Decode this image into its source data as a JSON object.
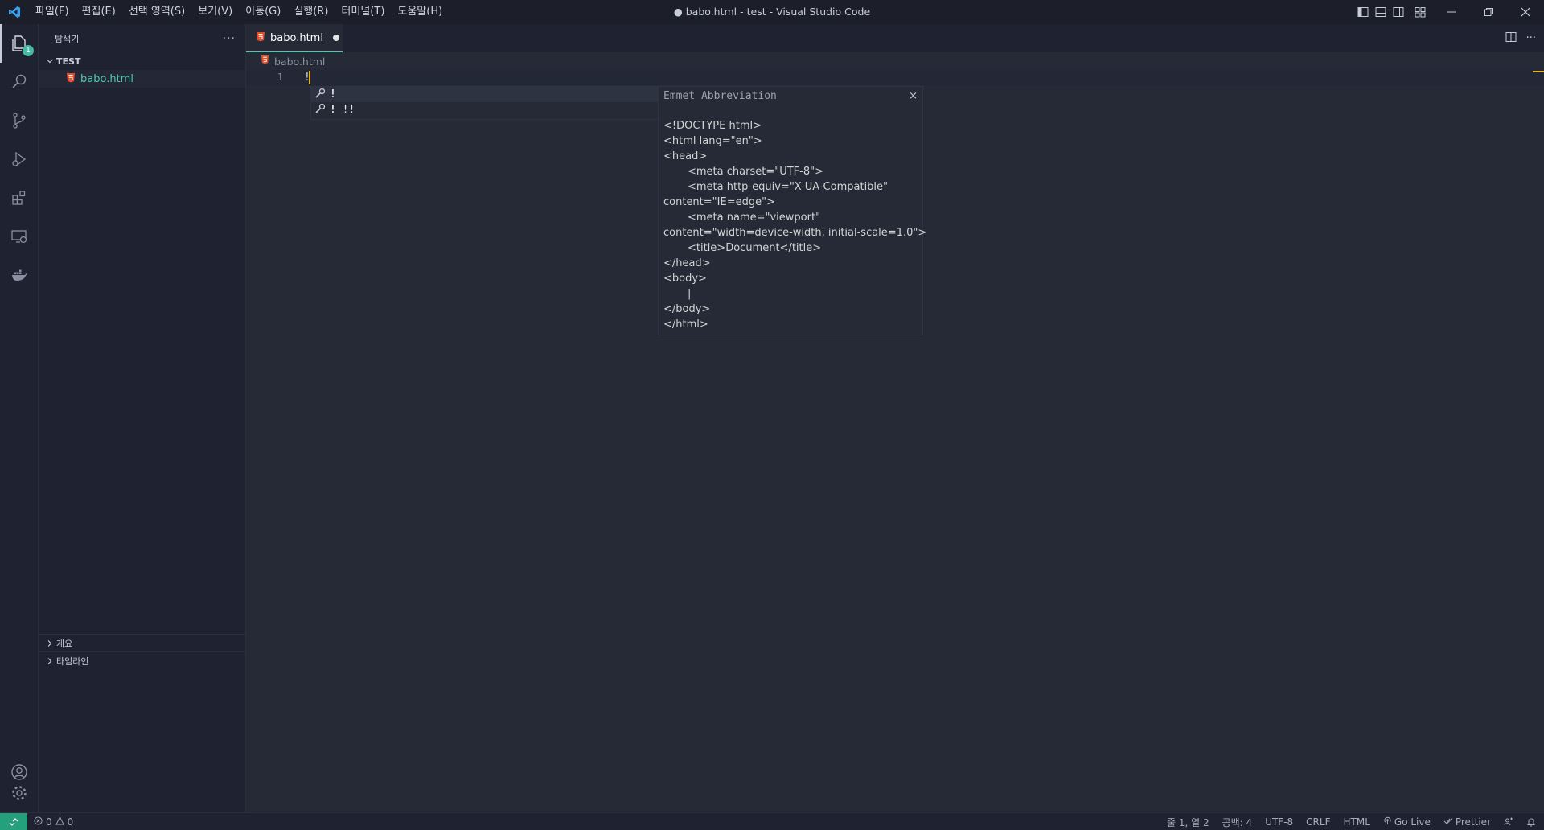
{
  "titlebar": {
    "title": "● babo.html - test - Visual Studio Code",
    "menu": [
      "파일(F)",
      "편집(E)",
      "선택 영역(S)",
      "보기(V)",
      "이동(G)",
      "실행(R)",
      "터미널(T)",
      "도움말(H)"
    ]
  },
  "activity": {
    "explorer_badge": "1"
  },
  "sidebar": {
    "title": "탐색기",
    "more": "···",
    "folder": "TEST",
    "file": "babo.html",
    "outline": "개요",
    "timeline": "타임라인"
  },
  "editor": {
    "tab_label": "babo.html",
    "breadcrumb": "babo.html",
    "line_number": "1",
    "line_text": "!",
    "suggestions": [
      {
        "label": "!",
        "rest": ""
      },
      {
        "label": "!",
        "rest": " !!"
      }
    ],
    "details": {
      "title": "Emmet Abbreviation",
      "close": "×",
      "lines": [
        {
          "text": "<!DOCTYPE html>",
          "indent": false
        },
        {
          "text": "<html lang=\"en\">",
          "indent": false
        },
        {
          "text": "<head>",
          "indent": false
        },
        {
          "text": "<meta charset=\"UTF-8\">",
          "indent": true
        },
        {
          "text": "<meta http-equiv=\"X-UA-Compatible\"",
          "indent": true
        },
        {
          "text": "content=\"IE=edge\">",
          "indent": false
        },
        {
          "text": "<meta name=\"viewport\"",
          "indent": true
        },
        {
          "text": "content=\"width=device-width, initial-scale=1.0\">",
          "indent": false
        },
        {
          "text": "<title>Document</title>",
          "indent": true
        },
        {
          "text": "</head>",
          "indent": false
        },
        {
          "text": "<body>",
          "indent": false
        },
        {
          "text": "|",
          "indent": true
        },
        {
          "text": "</body>",
          "indent": false
        },
        {
          "text": "</html>",
          "indent": false
        }
      ]
    }
  },
  "status": {
    "errors": "0",
    "warnings": "0",
    "position": "줄 1, 열 2",
    "spaces": "공백: 4",
    "encoding": "UTF-8",
    "eol": "CRLF",
    "language": "HTML",
    "golive": "Go Live",
    "prettier": "Prettier"
  },
  "colors": {
    "accent": "#4ec9b0",
    "html_icon": "#e44d26",
    "cursor": "#e6b422",
    "remote": "#25a07d"
  }
}
